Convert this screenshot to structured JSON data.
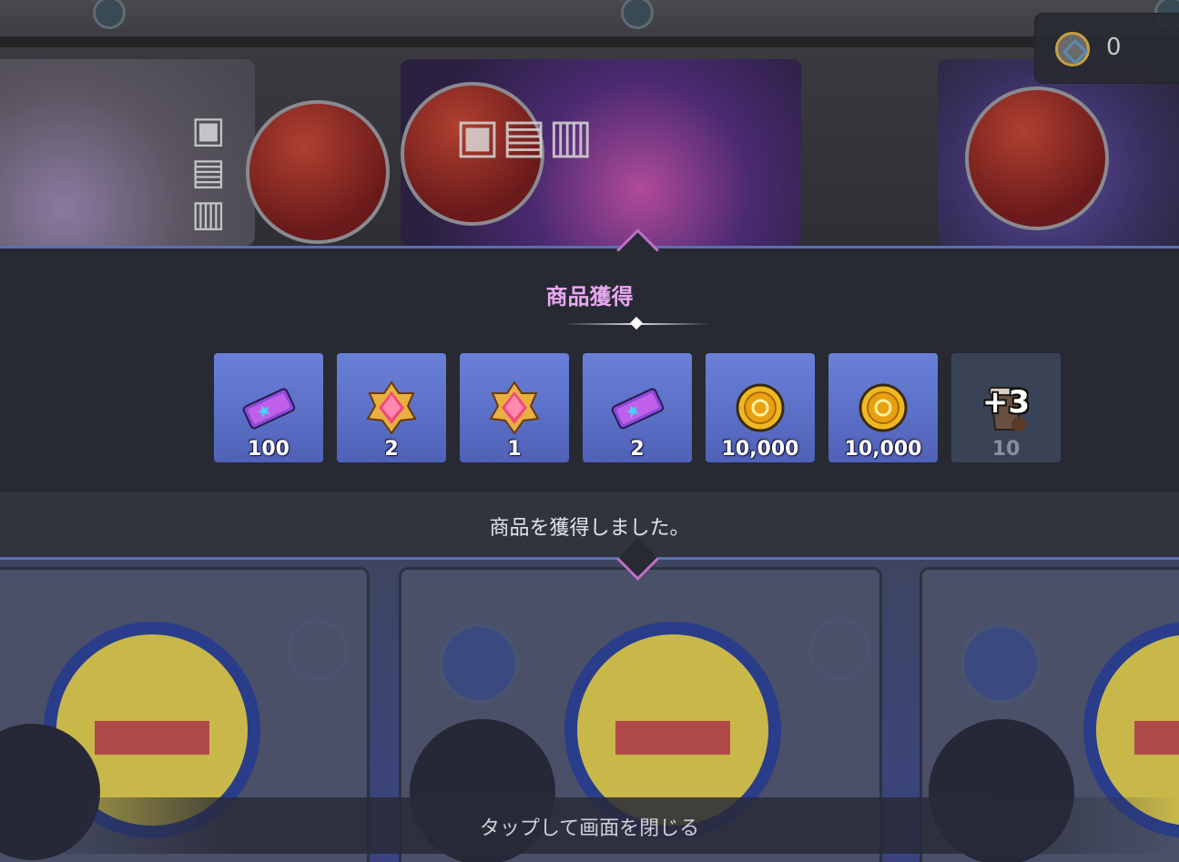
{
  "coin_counter": {
    "value": "0",
    "icon": "gear-coin-icon"
  },
  "modal": {
    "title": "商品獲得",
    "message": "商品を獲得しました。"
  },
  "items": [
    {
      "icon": "ticket-icon",
      "qty": "100"
    },
    {
      "icon": "gem-badge-icon",
      "qty": "2"
    },
    {
      "icon": "gem-badge-icon",
      "qty": "1"
    },
    {
      "icon": "ticket-icon",
      "qty": "2"
    },
    {
      "icon": "gold-coin-icon",
      "qty": "10,000"
    },
    {
      "icon": "gold-coin-icon",
      "qty": "10,000"
    },
    {
      "icon": "coffee-cup-icon",
      "qty": "10",
      "more": "+3"
    }
  ],
  "close_hint": "タップして画面を閉じる",
  "colors": {
    "accent": "#e8a8f0",
    "item_bg": "#5a6ec8",
    "frame_line": "#5a6fb0"
  }
}
